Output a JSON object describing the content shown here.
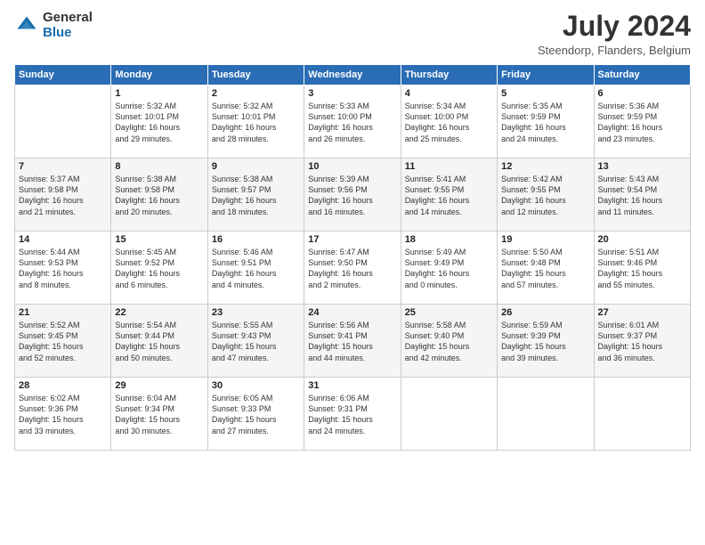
{
  "header": {
    "logo_general": "General",
    "logo_blue": "Blue",
    "month_year": "July 2024",
    "location": "Steendorp, Flanders, Belgium"
  },
  "weekdays": [
    "Sunday",
    "Monday",
    "Tuesday",
    "Wednesday",
    "Thursday",
    "Friday",
    "Saturday"
  ],
  "weeks": [
    [
      {
        "day": "",
        "info": ""
      },
      {
        "day": "1",
        "info": "Sunrise: 5:32 AM\nSunset: 10:01 PM\nDaylight: 16 hours\nand 29 minutes."
      },
      {
        "day": "2",
        "info": "Sunrise: 5:32 AM\nSunset: 10:01 PM\nDaylight: 16 hours\nand 28 minutes."
      },
      {
        "day": "3",
        "info": "Sunrise: 5:33 AM\nSunset: 10:00 PM\nDaylight: 16 hours\nand 26 minutes."
      },
      {
        "day": "4",
        "info": "Sunrise: 5:34 AM\nSunset: 10:00 PM\nDaylight: 16 hours\nand 25 minutes."
      },
      {
        "day": "5",
        "info": "Sunrise: 5:35 AM\nSunset: 9:59 PM\nDaylight: 16 hours\nand 24 minutes."
      },
      {
        "day": "6",
        "info": "Sunrise: 5:36 AM\nSunset: 9:59 PM\nDaylight: 16 hours\nand 23 minutes."
      }
    ],
    [
      {
        "day": "7",
        "info": "Sunrise: 5:37 AM\nSunset: 9:58 PM\nDaylight: 16 hours\nand 21 minutes."
      },
      {
        "day": "8",
        "info": "Sunrise: 5:38 AM\nSunset: 9:58 PM\nDaylight: 16 hours\nand 20 minutes."
      },
      {
        "day": "9",
        "info": "Sunrise: 5:38 AM\nSunset: 9:57 PM\nDaylight: 16 hours\nand 18 minutes."
      },
      {
        "day": "10",
        "info": "Sunrise: 5:39 AM\nSunset: 9:56 PM\nDaylight: 16 hours\nand 16 minutes."
      },
      {
        "day": "11",
        "info": "Sunrise: 5:41 AM\nSunset: 9:55 PM\nDaylight: 16 hours\nand 14 minutes."
      },
      {
        "day": "12",
        "info": "Sunrise: 5:42 AM\nSunset: 9:55 PM\nDaylight: 16 hours\nand 12 minutes."
      },
      {
        "day": "13",
        "info": "Sunrise: 5:43 AM\nSunset: 9:54 PM\nDaylight: 16 hours\nand 11 minutes."
      }
    ],
    [
      {
        "day": "14",
        "info": "Sunrise: 5:44 AM\nSunset: 9:53 PM\nDaylight: 16 hours\nand 8 minutes."
      },
      {
        "day": "15",
        "info": "Sunrise: 5:45 AM\nSunset: 9:52 PM\nDaylight: 16 hours\nand 6 minutes."
      },
      {
        "day": "16",
        "info": "Sunrise: 5:46 AM\nSunset: 9:51 PM\nDaylight: 16 hours\nand 4 minutes."
      },
      {
        "day": "17",
        "info": "Sunrise: 5:47 AM\nSunset: 9:50 PM\nDaylight: 16 hours\nand 2 minutes."
      },
      {
        "day": "18",
        "info": "Sunrise: 5:49 AM\nSunset: 9:49 PM\nDaylight: 16 hours\nand 0 minutes."
      },
      {
        "day": "19",
        "info": "Sunrise: 5:50 AM\nSunset: 9:48 PM\nDaylight: 15 hours\nand 57 minutes."
      },
      {
        "day": "20",
        "info": "Sunrise: 5:51 AM\nSunset: 9:46 PM\nDaylight: 15 hours\nand 55 minutes."
      }
    ],
    [
      {
        "day": "21",
        "info": "Sunrise: 5:52 AM\nSunset: 9:45 PM\nDaylight: 15 hours\nand 52 minutes."
      },
      {
        "day": "22",
        "info": "Sunrise: 5:54 AM\nSunset: 9:44 PM\nDaylight: 15 hours\nand 50 minutes."
      },
      {
        "day": "23",
        "info": "Sunrise: 5:55 AM\nSunset: 9:43 PM\nDaylight: 15 hours\nand 47 minutes."
      },
      {
        "day": "24",
        "info": "Sunrise: 5:56 AM\nSunset: 9:41 PM\nDaylight: 15 hours\nand 44 minutes."
      },
      {
        "day": "25",
        "info": "Sunrise: 5:58 AM\nSunset: 9:40 PM\nDaylight: 15 hours\nand 42 minutes."
      },
      {
        "day": "26",
        "info": "Sunrise: 5:59 AM\nSunset: 9:39 PM\nDaylight: 15 hours\nand 39 minutes."
      },
      {
        "day": "27",
        "info": "Sunrise: 6:01 AM\nSunset: 9:37 PM\nDaylight: 15 hours\nand 36 minutes."
      }
    ],
    [
      {
        "day": "28",
        "info": "Sunrise: 6:02 AM\nSunset: 9:36 PM\nDaylight: 15 hours\nand 33 minutes."
      },
      {
        "day": "29",
        "info": "Sunrise: 6:04 AM\nSunset: 9:34 PM\nDaylight: 15 hours\nand 30 minutes."
      },
      {
        "day": "30",
        "info": "Sunrise: 6:05 AM\nSunset: 9:33 PM\nDaylight: 15 hours\nand 27 minutes."
      },
      {
        "day": "31",
        "info": "Sunrise: 6:06 AM\nSunset: 9:31 PM\nDaylight: 15 hours\nand 24 minutes."
      },
      {
        "day": "",
        "info": ""
      },
      {
        "day": "",
        "info": ""
      },
      {
        "day": "",
        "info": ""
      }
    ]
  ]
}
